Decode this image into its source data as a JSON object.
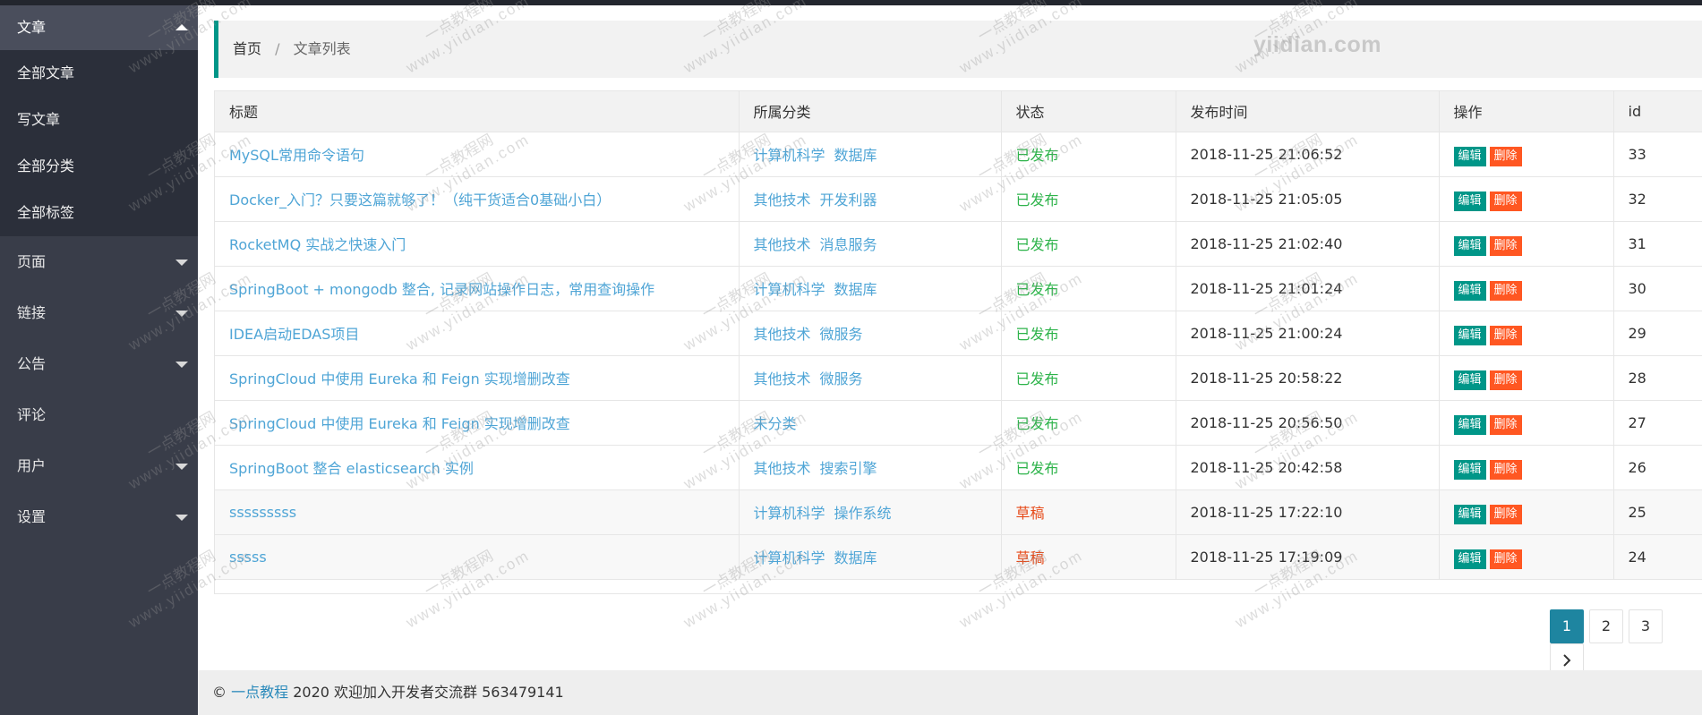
{
  "sidebar": {
    "sections": [
      {
        "label": "文章",
        "expanded": true,
        "items": [
          {
            "label": "全部文章"
          },
          {
            "label": "写文章"
          },
          {
            "label": "全部分类"
          },
          {
            "label": "全部标签"
          }
        ]
      },
      {
        "label": "页面",
        "expanded": false
      },
      {
        "label": "链接",
        "expanded": false
      },
      {
        "label": "公告",
        "expanded": false
      },
      {
        "label": "评论",
        "expanded": false
      },
      {
        "label": "用户",
        "expanded": false
      },
      {
        "label": "设置",
        "expanded": false
      }
    ]
  },
  "breadcrumb": {
    "home": "首页",
    "separator": "/",
    "current": "文章列表"
  },
  "brand_logo": "yiidian.com",
  "table": {
    "columns": [
      "标题",
      "所属分类",
      "状态",
      "发布时间",
      "操作",
      "id"
    ],
    "edit_label": "编辑",
    "delete_label": "删除",
    "rows": [
      {
        "title": "MySQL常用命令语句",
        "categories": [
          "计算机科学",
          "数据库"
        ],
        "status": "已发布",
        "status_type": "published",
        "time": "2018-11-25 21:06:52",
        "id": "33"
      },
      {
        "title": "Docker_入门？只要这篇就够了！（纯干货适合0基础小白）",
        "categories": [
          "其他技术",
          "开发利器"
        ],
        "status": "已发布",
        "status_type": "published",
        "time": "2018-11-25 21:05:05",
        "id": "32"
      },
      {
        "title": "RocketMQ 实战之快速入门",
        "categories": [
          "其他技术",
          "消息服务"
        ],
        "status": "已发布",
        "status_type": "published",
        "time": "2018-11-25 21:02:40",
        "id": "31"
      },
      {
        "title": "SpringBoot + mongodb 整合, 记录网站操作日志，常用查询操作",
        "categories": [
          "计算机科学",
          "数据库"
        ],
        "status": "已发布",
        "status_type": "published",
        "time": "2018-11-25 21:01:24",
        "id": "30"
      },
      {
        "title": "IDEA启动EDAS项目",
        "categories": [
          "其他技术",
          "微服务"
        ],
        "status": "已发布",
        "status_type": "published",
        "time": "2018-11-25 21:00:24",
        "id": "29"
      },
      {
        "title": "SpringCloud 中使用 Eureka 和 Feign 实现增删改查",
        "categories": [
          "其他技术",
          "微服务"
        ],
        "status": "已发布",
        "status_type": "published",
        "time": "2018-11-25 20:58:22",
        "id": "28"
      },
      {
        "title": "SpringCloud 中使用 Eureka 和 Feign 实现增删改查",
        "categories": [
          "未分类"
        ],
        "status": "已发布",
        "status_type": "published",
        "time": "2018-11-25 20:56:50",
        "id": "27"
      },
      {
        "title": "SpringBoot 整合 elasticsearch 实例",
        "categories": [
          "其他技术",
          "搜索引擎"
        ],
        "status": "已发布",
        "status_type": "published",
        "time": "2018-11-25 20:42:58",
        "id": "26"
      },
      {
        "title": "sssssssss",
        "categories": [
          "计算机科学",
          "操作系统"
        ],
        "status": "草稿",
        "status_type": "draft",
        "time": "2018-11-25 17:22:10",
        "id": "25"
      },
      {
        "title": "sssss",
        "categories": [
          "计算机科学",
          "数据库"
        ],
        "status": "草稿",
        "status_type": "draft",
        "time": "2018-11-25 17:19:09",
        "id": "24"
      }
    ]
  },
  "pagination": {
    "pages": [
      "1",
      "2",
      "3"
    ],
    "current": "1"
  },
  "footer": {
    "copyright": "©",
    "brand": "一点教程",
    "text": "2020 欢迎加入开发者交流群 563479141"
  },
  "watermark": {
    "line1": "一点教程网",
    "line2": "www.yiidian.com"
  },
  "colors": {
    "sidebar": "#393d49",
    "accent": "#009688",
    "danger": "#ff5722",
    "link": "#4fa5d6",
    "published": "#2db34a",
    "draft": "#e64a19"
  }
}
